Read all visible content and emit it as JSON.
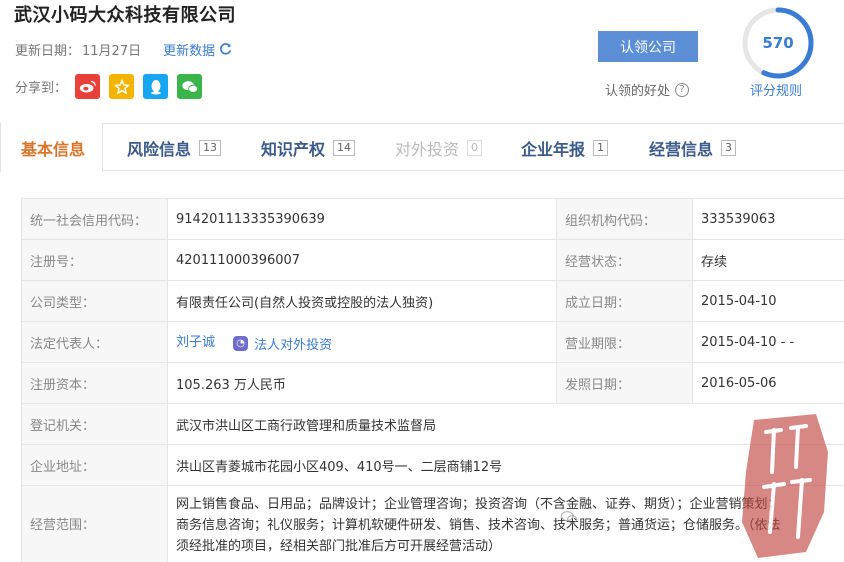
{
  "header": {
    "company_name": "武汉小码大众科技有限公司",
    "update_label": "更新日期：",
    "update_date": "11月27日",
    "refresh_label": "更新数据",
    "share_label": "分享到："
  },
  "claim": {
    "button_label": "认领公司",
    "benefit_label": "认领的好处"
  },
  "score": {
    "value": "570",
    "fraction": 0.57,
    "rule_label": "评分规则",
    "color": "#3a7bd5"
  },
  "tabs": [
    {
      "label": "基本信息",
      "count": ""
    },
    {
      "label": "风险信息",
      "count": "13"
    },
    {
      "label": "知识产权",
      "count": "14"
    },
    {
      "label": "对外投资",
      "count": "0"
    },
    {
      "label": "企业年报",
      "count": "1"
    },
    {
      "label": "经营信息",
      "count": "3"
    }
  ],
  "info": {
    "credit_code_label": "统一社会信用代码：",
    "credit_code": "914201113335390639",
    "org_code_label": "组织机构代码：",
    "org_code": "333539063",
    "reg_no_label": "注册号：",
    "reg_no": "420111000396007",
    "status_label": "经营状态：",
    "status": "存续",
    "type_label": "公司类型：",
    "type": "有限责任公司(自然人投资或控股的法人独资)",
    "founded_label": "成立日期：",
    "founded": "2015-04-10",
    "legal_rep_label": "法定代表人：",
    "legal_rep": "刘子诚",
    "legal_invest_label": "法人对外投资",
    "term_label": "营业期限：",
    "term": "2015-04-10 - -",
    "capital_label": "注册资本：",
    "capital": "105.263 万人民币",
    "issue_label": "发照日期：",
    "issue_date": "2016-05-06",
    "authority_label": "登记机关：",
    "authority": "武汉市洪山区工商行政管理和质量技术监督局",
    "address_label": "企业地址：",
    "address": "洪山区青菱城市花园小区409、410号一、二层商铺12号",
    "scope_label": "经营范围：",
    "scope_line1": "网上销售食品、日用品；品牌设计；企业管理咨询；投资咨询（不含金融、证券、期货）；企业营销策划；",
    "scope_line2": "商务信息咨询；礼仪服务；计算机软硬件研发、销售、技术咨询、技术服务；普通货运；仓储服务。（依法",
    "scope_line3": "须经批准的项目，经相关部门批准后方可开展经营活动）"
  }
}
